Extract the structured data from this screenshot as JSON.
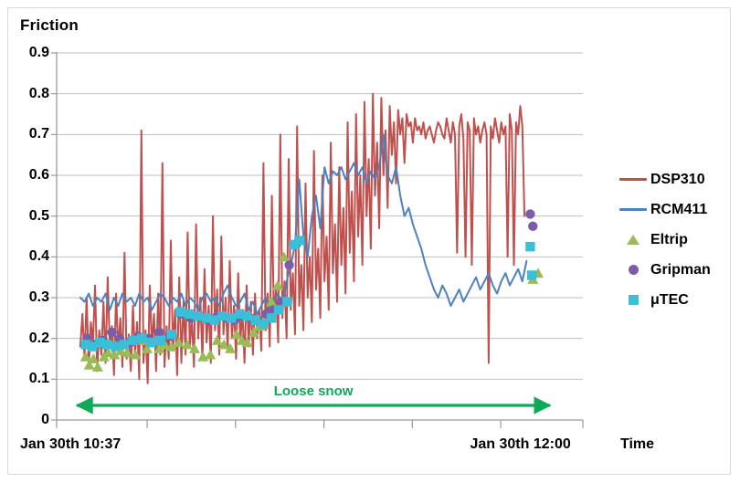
{
  "chart_data": {
    "type": "line",
    "title": "",
    "ylabel": "Friction",
    "xlabel": "Time",
    "ylim": [
      0,
      0.9
    ],
    "ygrid": true,
    "yticks": [
      "0",
      "0.1",
      "0.2",
      "0.3",
      "0.4",
      "0.5",
      "0.6",
      "0.7",
      "0.8",
      "0.9"
    ],
    "ytick_values": [
      0,
      0.1,
      0.2,
      0.3,
      0.4,
      0.5,
      0.6,
      0.7,
      0.8,
      0.9
    ],
    "xtick_labels": [
      "Jan 30th 10:37",
      "Jan 30th 12:00"
    ],
    "xtick_label_positions": [
      0.0,
      0.855
    ],
    "legend_position": "right",
    "annotations": [
      {
        "text": "Loose snow",
        "color": "#0FA958",
        "type": "double-arrow",
        "x_start": 0.028,
        "x_end": 0.948,
        "y": 0.0
      }
    ],
    "series": [
      {
        "name": "DSP310",
        "type": "line",
        "color": "#C0504D",
        "x": [
          0.045,
          0.049,
          0.053,
          0.057,
          0.061,
          0.065,
          0.069,
          0.073,
          0.077,
          0.081,
          0.085,
          0.089,
          0.093,
          0.097,
          0.101,
          0.105,
          0.109,
          0.113,
          0.117,
          0.121,
          0.125,
          0.129,
          0.133,
          0.137,
          0.141,
          0.145,
          0.149,
          0.153,
          0.157,
          0.161,
          0.165,
          0.169,
          0.173,
          0.177,
          0.181,
          0.185,
          0.189,
          0.193,
          0.197,
          0.201,
          0.205,
          0.209,
          0.213,
          0.217,
          0.221,
          0.225,
          0.229,
          0.233,
          0.237,
          0.241,
          0.245,
          0.249,
          0.253,
          0.257,
          0.261,
          0.265,
          0.269,
          0.273,
          0.277,
          0.281,
          0.285,
          0.289,
          0.293,
          0.297,
          0.301,
          0.305,
          0.309,
          0.313,
          0.317,
          0.321,
          0.325,
          0.329,
          0.333,
          0.337,
          0.341,
          0.345,
          0.349,
          0.353,
          0.357,
          0.361,
          0.365,
          0.369,
          0.373,
          0.377,
          0.381,
          0.385,
          0.389,
          0.393,
          0.397,
          0.401,
          0.405,
          0.409,
          0.413,
          0.417,
          0.421,
          0.425,
          0.429,
          0.433,
          0.437,
          0.441,
          0.445,
          0.449,
          0.453,
          0.457,
          0.461,
          0.465,
          0.469,
          0.473,
          0.477,
          0.481,
          0.485,
          0.489,
          0.493,
          0.497,
          0.501,
          0.505,
          0.509,
          0.513,
          0.517,
          0.521,
          0.525,
          0.529,
          0.533,
          0.537,
          0.541,
          0.545,
          0.549,
          0.553,
          0.557,
          0.561,
          0.565,
          0.569,
          0.573,
          0.577,
          0.581,
          0.585,
          0.589,
          0.593,
          0.597,
          0.601,
          0.605,
          0.609,
          0.613,
          0.617,
          0.621,
          0.625,
          0.629,
          0.633,
          0.637,
          0.641,
          0.645,
          0.649,
          0.653,
          0.657,
          0.661,
          0.665,
          0.669,
          0.673,
          0.677,
          0.681,
          0.685,
          0.689,
          0.693,
          0.697,
          0.701,
          0.705,
          0.709,
          0.713,
          0.717,
          0.721,
          0.725,
          0.729,
          0.733,
          0.737,
          0.741,
          0.745,
          0.749,
          0.753,
          0.757,
          0.761,
          0.765,
          0.769,
          0.773,
          0.777,
          0.781,
          0.785,
          0.789,
          0.793,
          0.797,
          0.801,
          0.805,
          0.809,
          0.813,
          0.817,
          0.821,
          0.825,
          0.829,
          0.833,
          0.837,
          0.841,
          0.845,
          0.849,
          0.853,
          0.857,
          0.861,
          0.865,
          0.869,
          0.873,
          0.877,
          0.881,
          0.885,
          0.889,
          0.893,
          0.897
        ],
        "y": [
          0.18,
          0.26,
          0.15,
          0.3,
          0.13,
          0.24,
          0.19,
          0.33,
          0.12,
          0.22,
          0.16,
          0.29,
          0.14,
          0.35,
          0.18,
          0.23,
          0.11,
          0.31,
          0.17,
          0.25,
          0.13,
          0.41,
          0.15,
          0.21,
          0.12,
          0.28,
          0.16,
          0.24,
          0.1,
          0.71,
          0.14,
          0.22,
          0.09,
          0.33,
          0.18,
          0.26,
          0.12,
          0.31,
          0.16,
          0.63,
          0.13,
          0.23,
          0.15,
          0.44,
          0.17,
          0.27,
          0.11,
          0.35,
          0.14,
          0.29,
          0.16,
          0.46,
          0.18,
          0.25,
          0.13,
          0.48,
          0.2,
          0.3,
          0.15,
          0.37,
          0.19,
          0.28,
          0.14,
          0.5,
          0.22,
          0.32,
          0.16,
          0.45,
          0.21,
          0.3,
          0.17,
          0.39,
          0.2,
          0.28,
          0.15,
          0.36,
          0.19,
          0.27,
          0.14,
          0.33,
          0.18,
          0.29,
          0.16,
          0.31,
          0.2,
          0.27,
          0.17,
          0.63,
          0.22,
          0.31,
          0.18,
          0.55,
          0.24,
          0.33,
          0.19,
          0.7,
          0.25,
          0.34,
          0.2,
          0.64,
          0.27,
          0.36,
          0.21,
          0.72,
          0.28,
          0.38,
          0.22,
          0.58,
          0.3,
          0.4,
          0.24,
          0.66,
          0.32,
          0.42,
          0.25,
          0.6,
          0.34,
          0.45,
          0.27,
          0.68,
          0.36,
          0.48,
          0.29,
          0.62,
          0.38,
          0.52,
          0.31,
          0.73,
          0.41,
          0.56,
          0.34,
          0.75,
          0.45,
          0.6,
          0.38,
          0.78,
          0.5,
          0.64,
          0.42,
          0.8,
          0.55,
          0.68,
          0.47,
          0.79,
          0.6,
          0.71,
          0.52,
          0.77,
          0.65,
          0.73,
          0.58,
          0.76,
          0.7,
          0.74,
          0.63,
          0.75,
          0.72,
          0.73,
          0.68,
          0.74,
          0.71,
          0.72,
          0.7,
          0.73,
          0.69,
          0.71,
          0.72,
          0.7,
          0.68,
          0.71,
          0.73,
          0.72,
          0.7,
          0.69,
          0.74,
          0.71,
          0.68,
          0.73,
          0.7,
          0.41,
          0.72,
          0.75,
          0.69,
          0.4,
          0.73,
          0.71,
          0.38,
          0.74,
          0.7,
          0.72,
          0.68,
          0.71,
          0.73,
          0.7,
          0.14,
          0.72,
          0.69,
          0.74,
          0.71,
          0.68,
          0.73,
          0.7,
          0.72,
          0.4,
          0.75,
          0.71,
          0.38,
          0.73,
          0.7,
          0.77,
          0.72,
          0.5
        ]
      },
      {
        "name": "RCM411",
        "type": "line",
        "color": "#4F81BD",
        "x": [
          0.045,
          0.053,
          0.061,
          0.069,
          0.077,
          0.085,
          0.093,
          0.101,
          0.109,
          0.117,
          0.125,
          0.133,
          0.141,
          0.149,
          0.157,
          0.165,
          0.173,
          0.181,
          0.189,
          0.197,
          0.205,
          0.213,
          0.221,
          0.229,
          0.237,
          0.245,
          0.253,
          0.261,
          0.269,
          0.277,
          0.285,
          0.293,
          0.301,
          0.309,
          0.317,
          0.325,
          0.333,
          0.341,
          0.349,
          0.357,
          0.365,
          0.373,
          0.381,
          0.389,
          0.397,
          0.405,
          0.413,
          0.421,
          0.429,
          0.437,
          0.445,
          0.453,
          0.461,
          0.469,
          0.477,
          0.485,
          0.493,
          0.501,
          0.509,
          0.517,
          0.525,
          0.533,
          0.541,
          0.549,
          0.557,
          0.565,
          0.573,
          0.581,
          0.589,
          0.597,
          0.605,
          0.613,
          0.621,
          0.629,
          0.637,
          0.645,
          0.653,
          0.661,
          0.669,
          0.677,
          0.685,
          0.693,
          0.701,
          0.709,
          0.717,
          0.725,
          0.733,
          0.741,
          0.749,
          0.757,
          0.765,
          0.773,
          0.781,
          0.789,
          0.797,
          0.805,
          0.813,
          0.821,
          0.829,
          0.837,
          0.845,
          0.853,
          0.861,
          0.869,
          0.877,
          0.885,
          0.893
        ],
        "y": [
          0.3,
          0.29,
          0.31,
          0.28,
          0.3,
          0.29,
          0.31,
          0.27,
          0.3,
          0.28,
          0.31,
          0.29,
          0.3,
          0.28,
          0.31,
          0.29,
          0.3,
          0.27,
          0.29,
          0.31,
          0.3,
          0.28,
          0.3,
          0.29,
          0.31,
          0.28,
          0.3,
          0.29,
          0.27,
          0.3,
          0.31,
          0.29,
          0.3,
          0.28,
          0.31,
          0.33,
          0.3,
          0.28,
          0.29,
          0.31,
          0.27,
          0.29,
          0.26,
          0.28,
          0.3,
          0.27,
          0.29,
          0.31,
          0.28,
          0.34,
          0.38,
          0.43,
          0.59,
          0.45,
          0.4,
          0.5,
          0.55,
          0.47,
          0.62,
          0.58,
          0.61,
          0.6,
          0.62,
          0.59,
          0.61,
          0.63,
          0.6,
          0.62,
          0.58,
          0.61,
          0.59,
          0.62,
          0.7,
          0.6,
          0.58,
          0.62,
          0.55,
          0.5,
          0.52,
          0.48,
          0.45,
          0.42,
          0.38,
          0.35,
          0.32,
          0.3,
          0.33,
          0.31,
          0.28,
          0.3,
          0.32,
          0.29,
          0.31,
          0.33,
          0.35,
          0.32,
          0.34,
          0.36,
          0.33,
          0.31,
          0.34,
          0.36,
          0.33,
          0.35,
          0.37,
          0.34,
          0.39
        ]
      },
      {
        "name": "Eltrip",
        "type": "scatter",
        "marker": "triangle",
        "color": "#9BBB59",
        "points": [
          [
            0.055,
            0.155
          ],
          [
            0.062,
            0.135
          ],
          [
            0.07,
            0.15
          ],
          [
            0.078,
            0.13
          ],
          [
            0.09,
            0.155
          ],
          [
            0.098,
            0.165
          ],
          [
            0.11,
            0.16
          ],
          [
            0.122,
            0.17
          ],
          [
            0.134,
            0.165
          ],
          [
            0.15,
            0.16
          ],
          [
            0.165,
            0.195
          ],
          [
            0.172,
            0.175
          ],
          [
            0.18,
            0.19
          ],
          [
            0.195,
            0.175
          ],
          [
            0.205,
            0.185
          ],
          [
            0.218,
            0.18
          ],
          [
            0.232,
            0.19
          ],
          [
            0.248,
            0.185
          ],
          [
            0.262,
            0.175
          ],
          [
            0.278,
            0.155
          ],
          [
            0.292,
            0.16
          ],
          [
            0.305,
            0.195
          ],
          [
            0.318,
            0.185
          ],
          [
            0.33,
            0.175
          ],
          [
            0.342,
            0.21
          ],
          [
            0.352,
            0.195
          ],
          [
            0.362,
            0.19
          ],
          [
            0.375,
            0.215
          ],
          [
            0.385,
            0.23
          ],
          [
            0.398,
            0.25
          ],
          [
            0.408,
            0.29
          ],
          [
            0.42,
            0.33
          ],
          [
            0.432,
            0.4
          ],
          [
            0.905,
            0.345
          ],
          [
            0.915,
            0.36
          ]
        ]
      },
      {
        "name": "Gripman",
        "type": "scatter",
        "marker": "circle",
        "color": "#7B5EA7",
        "points": [
          [
            0.058,
            0.2
          ],
          [
            0.072,
            0.185
          ],
          [
            0.088,
            0.195
          ],
          [
            0.105,
            0.215
          ],
          [
            0.12,
            0.2
          ],
          [
            0.14,
            0.19
          ],
          [
            0.155,
            0.205
          ],
          [
            0.175,
            0.2
          ],
          [
            0.195,
            0.215
          ],
          [
            0.215,
            0.205
          ],
          [
            0.235,
            0.26
          ],
          [
            0.255,
            0.25
          ],
          [
            0.272,
            0.255
          ],
          [
            0.288,
            0.245
          ],
          [
            0.305,
            0.255
          ],
          [
            0.322,
            0.25
          ],
          [
            0.338,
            0.245
          ],
          [
            0.352,
            0.255
          ],
          [
            0.368,
            0.25
          ],
          [
            0.382,
            0.245
          ],
          [
            0.398,
            0.26
          ],
          [
            0.412,
            0.27
          ],
          [
            0.428,
            0.29
          ],
          [
            0.442,
            0.38
          ],
          [
            0.455,
            0.43
          ],
          [
            0.9,
            0.505
          ],
          [
            0.905,
            0.475
          ]
        ]
      },
      {
        "name": "μTEC",
        "type": "scatter",
        "marker": "square",
        "color": "#3BBFD8",
        "points": [
          [
            0.055,
            0.185
          ],
          [
            0.068,
            0.18
          ],
          [
            0.082,
            0.19
          ],
          [
            0.095,
            0.185
          ],
          [
            0.112,
            0.18
          ],
          [
            0.128,
            0.185
          ],
          [
            0.145,
            0.195
          ],
          [
            0.162,
            0.2
          ],
          [
            0.18,
            0.19
          ],
          [
            0.198,
            0.195
          ],
          [
            0.218,
            0.21
          ],
          [
            0.235,
            0.265
          ],
          [
            0.252,
            0.26
          ],
          [
            0.268,
            0.255
          ],
          [
            0.285,
            0.25
          ],
          [
            0.3,
            0.245
          ],
          [
            0.315,
            0.255
          ],
          [
            0.332,
            0.25
          ],
          [
            0.348,
            0.26
          ],
          [
            0.362,
            0.255
          ],
          [
            0.378,
            0.245
          ],
          [
            0.392,
            0.235
          ],
          [
            0.408,
            0.25
          ],
          [
            0.422,
            0.27
          ],
          [
            0.438,
            0.29
          ],
          [
            0.452,
            0.43
          ],
          [
            0.462,
            0.44
          ],
          [
            0.9,
            0.425
          ],
          [
            0.903,
            0.355
          ]
        ]
      }
    ]
  },
  "legend": {
    "items": [
      {
        "label": "DSP310",
        "marker": "line",
        "color": "#C0504D"
      },
      {
        "label": "RCM411",
        "marker": "line",
        "color": "#4F81BD"
      },
      {
        "label": "Eltrip",
        "marker": "triangle",
        "color": "#9BBB59"
      },
      {
        "label": "Gripman",
        "marker": "circle",
        "color": "#7B5EA7"
      },
      {
        "label": "μTEC",
        "marker": "square",
        "color": "#3BBFD8"
      }
    ]
  }
}
